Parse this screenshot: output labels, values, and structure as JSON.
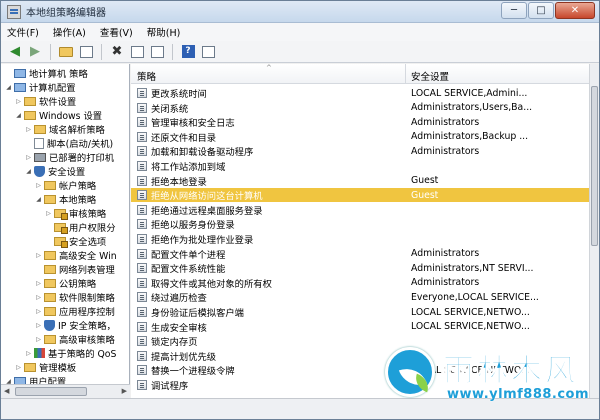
{
  "window": {
    "title": "本地组策略编辑器",
    "min_label": "─",
    "max_label": "□",
    "close_label": "✕"
  },
  "menu": [
    "文件(F)",
    "操作(A)",
    "查看(V)",
    "帮助(H)"
  ],
  "toolbar": {
    "icons": [
      "back-arrow-icon",
      "forward-arrow-icon",
      "up-folder-icon",
      "show-hide-tree-icon",
      "delete-icon",
      "properties-icon",
      "export-list-icon",
      "help-icon",
      "console-tree-icon"
    ]
  },
  "tree": [
    {
      "label": "地计算机 策略",
      "indent": 0,
      "icon": "computer-icon",
      "twist": ""
    },
    {
      "label": "计算机配置",
      "indent": 0,
      "icon": "computer-icon",
      "twist": "◢"
    },
    {
      "label": "软件设置",
      "indent": 1,
      "icon": "folder-icon",
      "twist": "▷"
    },
    {
      "label": "Windows 设置",
      "indent": 1,
      "icon": "folder-icon",
      "twist": "◢"
    },
    {
      "label": "域名解析策略",
      "indent": 2,
      "icon": "folder-icon",
      "twist": "▷"
    },
    {
      "label": "脚本(启动/关机)",
      "indent": 2,
      "icon": "document-icon",
      "twist": ""
    },
    {
      "label": "已部署的打印机",
      "indent": 2,
      "icon": "printer-icon",
      "twist": "▷"
    },
    {
      "label": "安全设置",
      "indent": 2,
      "icon": "shield-icon",
      "twist": "◢"
    },
    {
      "label": "帐户策略",
      "indent": 3,
      "icon": "folder-icon",
      "twist": "▷"
    },
    {
      "label": "本地策略",
      "indent": 3,
      "icon": "folder-icon",
      "twist": "◢"
    },
    {
      "label": "审核策略",
      "indent": 4,
      "icon": "folder-lock-icon",
      "twist": "▷"
    },
    {
      "label": "用户权限分",
      "indent": 4,
      "icon": "folder-lock-icon",
      "twist": ""
    },
    {
      "label": "安全选项",
      "indent": 4,
      "icon": "folder-lock-icon",
      "twist": ""
    },
    {
      "label": "高级安全 Win",
      "indent": 3,
      "icon": "folder-icon",
      "twist": "▷"
    },
    {
      "label": "网络列表管理",
      "indent": 3,
      "icon": "folder-icon",
      "twist": ""
    },
    {
      "label": "公钥策略",
      "indent": 3,
      "icon": "folder-icon",
      "twist": "▷"
    },
    {
      "label": "软件限制策略",
      "indent": 3,
      "icon": "folder-icon",
      "twist": "▷"
    },
    {
      "label": "应用程序控制",
      "indent": 3,
      "icon": "folder-icon",
      "twist": "▷"
    },
    {
      "label": "IP 安全策略，",
      "indent": 3,
      "icon": "shield-icon",
      "twist": "▷"
    },
    {
      "label": "高级审核策略",
      "indent": 3,
      "icon": "folder-icon",
      "twist": "▷"
    },
    {
      "label": "基于策略的 QoS",
      "indent": 2,
      "icon": "chart-icon",
      "twist": "▷"
    },
    {
      "label": "管理模板",
      "indent": 1,
      "icon": "folder-icon",
      "twist": "▷"
    },
    {
      "label": "用户配置",
      "indent": 0,
      "icon": "computer-icon",
      "twist": "◢"
    }
  ],
  "columns": {
    "policy": "策略",
    "setting": "安全设置"
  },
  "policies": [
    {
      "name": "更改系统时间",
      "value": "LOCAL SERVICE,Admini..."
    },
    {
      "name": "关闭系统",
      "value": "Administrators,Users,Ba..."
    },
    {
      "name": "管理审核和安全日志",
      "value": "Administrators"
    },
    {
      "name": "还原文件和目录",
      "value": "Administrators,Backup ..."
    },
    {
      "name": "加载和卸载设备驱动程序",
      "value": "Administrators"
    },
    {
      "name": "将工作站添加到域",
      "value": ""
    },
    {
      "name": "拒绝本地登录",
      "value": "Guest"
    },
    {
      "name": "拒绝从网络访问这台计算机",
      "value": "Guest",
      "selected": true
    },
    {
      "name": "拒绝通过远程桌面服务登录",
      "value": ""
    },
    {
      "name": "拒绝以服务身份登录",
      "value": ""
    },
    {
      "name": "拒绝作为批处理作业登录",
      "value": ""
    },
    {
      "name": "配置文件单个进程",
      "value": "Administrators"
    },
    {
      "name": "配置文件系统性能",
      "value": "Administrators,NT SERVI..."
    },
    {
      "name": "取得文件或其他对象的所有权",
      "value": "Administrators"
    },
    {
      "name": "绕过遍历检查",
      "value": "Everyone,LOCAL SERVICE..."
    },
    {
      "name": "身份验证后模拟客户端",
      "value": "LOCAL SERVICE,NETWO..."
    },
    {
      "name": "生成安全审核",
      "value": "LOCAL SERVICE,NETWO..."
    },
    {
      "name": "锁定内存页",
      "value": ""
    },
    {
      "name": "提高计划优先级",
      "value": ""
    },
    {
      "name": "替换一个进程级令牌",
      "value": "LOCAL SERVICE,NETWO..."
    },
    {
      "name": "调试程序",
      "value": ""
    }
  ],
  "watermark": {
    "title": "雨林木风",
    "url": "www.ylmf888.com"
  }
}
